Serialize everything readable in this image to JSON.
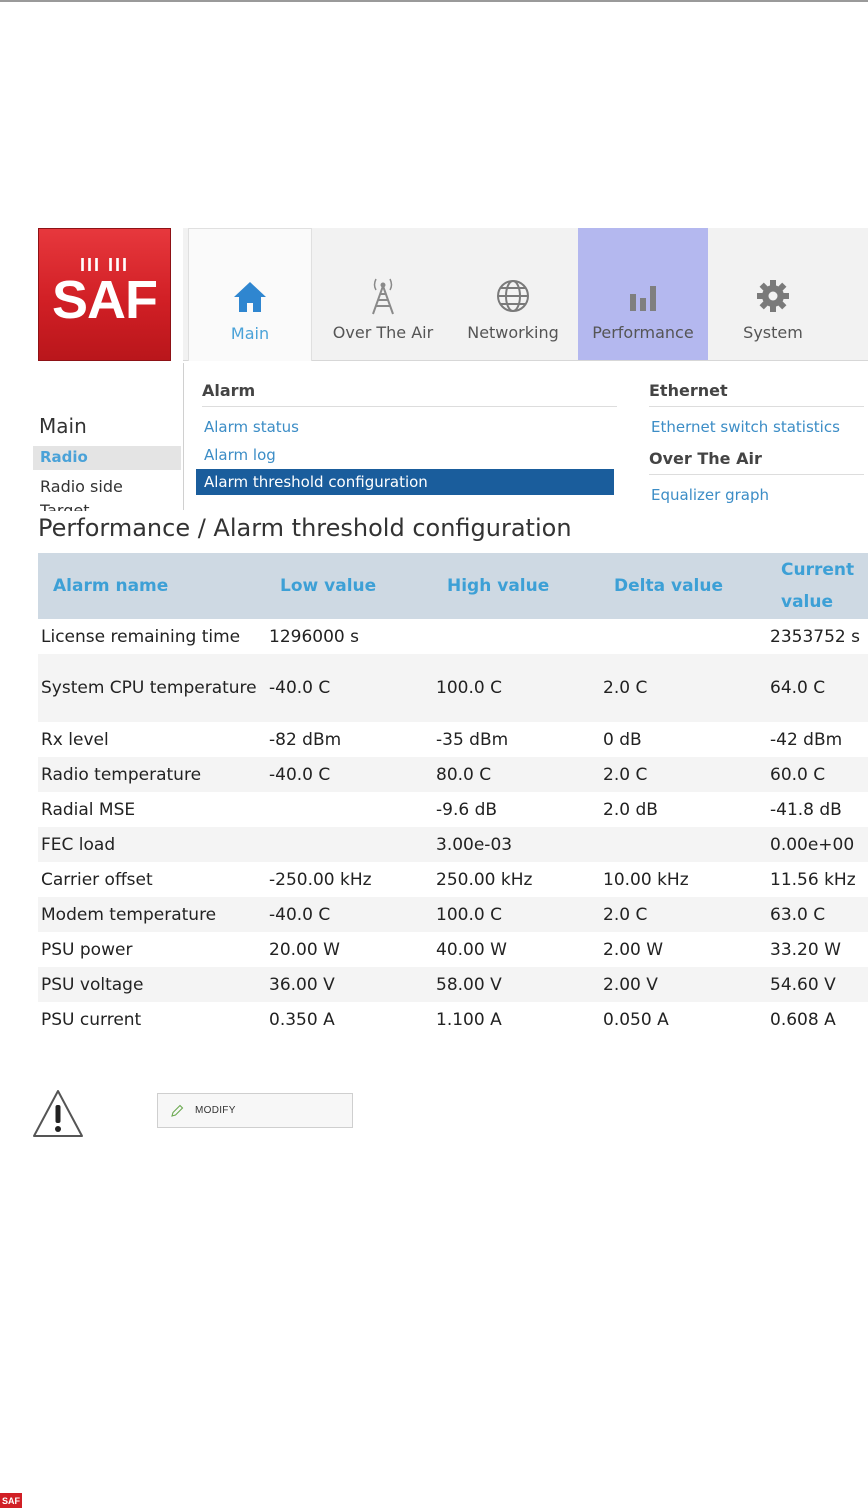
{
  "logo": {
    "ticks": "III  III",
    "word": "SAF"
  },
  "nav": {
    "tabs": [
      {
        "label": "Main",
        "icon": "home-icon"
      },
      {
        "label": "Over The Air",
        "icon": "antenna-icon"
      },
      {
        "label": "Networking",
        "icon": "globe-icon"
      },
      {
        "label": "Performance",
        "icon": "bar-chart-icon"
      },
      {
        "label": "System",
        "icon": "gear-icon"
      }
    ],
    "active_tab": "Main",
    "highlighted_tab": "Performance"
  },
  "sidebar": {
    "heading": "Main",
    "items": [
      "Radio",
      "Radio side",
      "Target"
    ]
  },
  "menu": {
    "alarm_heading": "Alarm",
    "alarm_items": [
      "Alarm status",
      "Alarm log",
      "Alarm threshold configuration"
    ],
    "selected_item": "Alarm threshold configuration",
    "ethernet_heading": "Ethernet",
    "ethernet_items": [
      "Ethernet switch statistics"
    ],
    "ota_heading": "Over The Air",
    "ota_items": [
      "Equalizer graph"
    ]
  },
  "page_title": "Performance / Alarm threshold configuration",
  "table": {
    "headers": [
      "Alarm name",
      "Low value",
      "High value",
      "Delta value",
      "Current value"
    ],
    "rows": [
      [
        "License remaining time",
        "1296000 s",
        "",
        "",
        "2353752 s"
      ],
      [
        "System CPU temperature",
        "-40.0 C",
        "100.0 C",
        "2.0 C",
        "64.0 C"
      ],
      [
        "Rx level",
        "-82 dBm",
        "-35 dBm",
        "0 dB",
        "-42 dBm"
      ],
      [
        "Radio temperature",
        "-40.0 C",
        "80.0 C",
        "2.0 C",
        "60.0 C"
      ],
      [
        "Radial MSE",
        "",
        "-9.6 dB",
        "2.0 dB",
        "-41.8 dB"
      ],
      [
        "FEC load",
        "",
        "3.00e-03",
        "",
        "0.00e+00"
      ],
      [
        "Carrier offset",
        "-250.00 kHz",
        "250.00 kHz",
        "10.00 kHz",
        "11.56 kHz"
      ],
      [
        "Modem temperature",
        "-40.0 C",
        "100.0 C",
        "2.0 C",
        "63.0 C"
      ],
      [
        "PSU power",
        "20.00 W",
        "40.00 W",
        "2.00 W",
        "33.20 W"
      ],
      [
        "PSU voltage",
        "36.00 V",
        "58.00 V",
        "2.00 V",
        "54.60 V"
      ],
      [
        "PSU current",
        "0.350 A",
        "1.100 A",
        "0.050 A",
        "0.608 A"
      ]
    ]
  },
  "modify_button": {
    "label": "MODIFY",
    "icon": "pencil-icon"
  },
  "warning": {
    "icon": "warning-icon"
  },
  "footer_logo": "SAF",
  "colors": {
    "brand_red": "#d11f25",
    "link_blue": "#3c8dc6",
    "selected_blue": "#1a5d9c",
    "header_bg": "#ced9e3",
    "performance_tab_bg": "#b4b8ef"
  }
}
